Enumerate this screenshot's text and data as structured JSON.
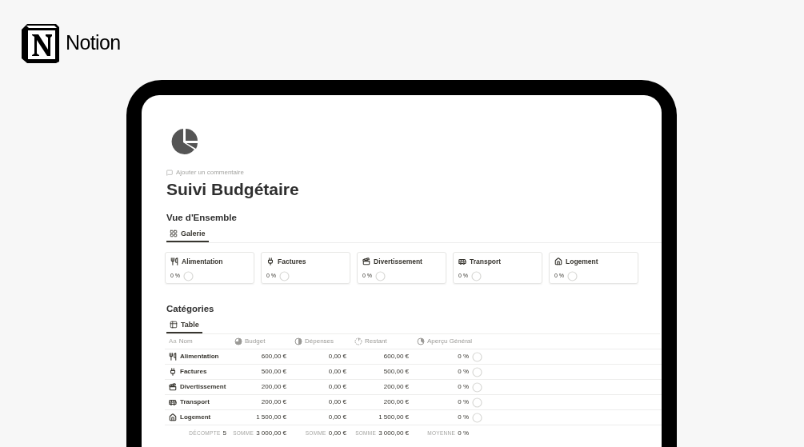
{
  "brand": {
    "name": "Notion"
  },
  "page": {
    "comment": "Ajouter un commentaire",
    "title": "Suivi Budgétaire"
  },
  "overview": {
    "heading": "Vue d'Ensemble",
    "tabs": [
      {
        "label": "Galerie",
        "selected": true
      }
    ],
    "cards": [
      {
        "name": "Alimentation",
        "percent": "0 %"
      },
      {
        "name": "Factures",
        "percent": "0 %"
      },
      {
        "name": "Divertissement",
        "percent": "0 %"
      },
      {
        "name": "Transport",
        "percent": "0 %"
      },
      {
        "name": "Logement",
        "percent": "0 %"
      }
    ]
  },
  "categories": {
    "heading": "Catégories",
    "tabs": [
      {
        "label": "Table",
        "selected": true
      }
    ],
    "table": {
      "columns": [
        {
          "label": "Nom",
          "prefix": "Aa"
        },
        {
          "label": "Budget"
        },
        {
          "label": "Dépenses"
        },
        {
          "label": "Restant"
        },
        {
          "label": "Aperçu Général"
        }
      ],
      "rows": [
        {
          "name": "Alimentation",
          "budget": "600,00 €",
          "spent": "0,00 €",
          "remaining": "600,00 €",
          "percent": "0 %"
        },
        {
          "name": "Factures",
          "budget": "500,00 €",
          "spent": "0,00 €",
          "remaining": "500,00 €",
          "percent": "0 %"
        },
        {
          "name": "Divertissement",
          "budget": "200,00 €",
          "spent": "0,00 €",
          "remaining": "200,00 €",
          "percent": "0 %"
        },
        {
          "name": "Transport",
          "budget": "200,00 €",
          "spent": "0,00 €",
          "remaining": "200,00 €",
          "percent": "0 %"
        },
        {
          "name": "Logement",
          "budget": "1 500,00 €",
          "spent": "0,00 €",
          "remaining": "1 500,00 €",
          "percent": "0 %"
        }
      ],
      "footer": [
        {
          "label": "DÉCOMPTE",
          "value": "5"
        },
        {
          "label": "SOMME",
          "value": "3 000,00 €"
        },
        {
          "label": "SOMME",
          "value": "0,00 €"
        },
        {
          "label": "SOMME",
          "value": "3 000,00 €"
        },
        {
          "label": "MOYENNE",
          "value": "0 %"
        }
      ]
    }
  }
}
